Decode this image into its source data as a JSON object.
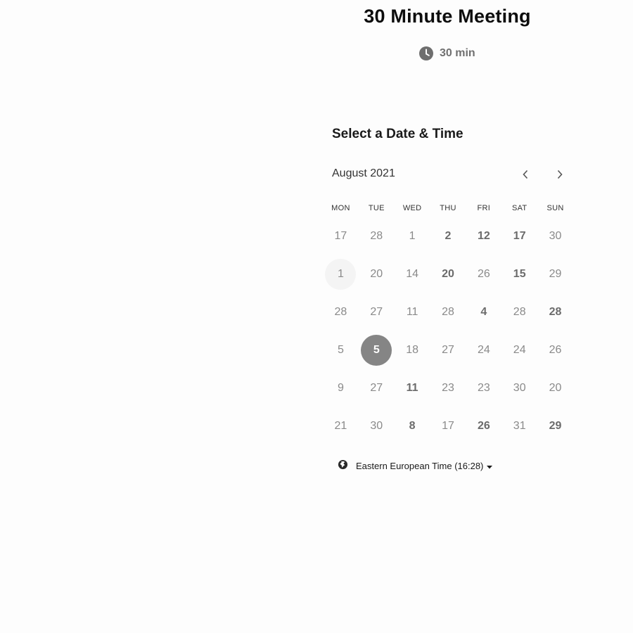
{
  "event": {
    "title": "30 Minute Meeting",
    "duration": "30 min"
  },
  "calendar": {
    "section_title": "Select a Date & Time",
    "month_label": "August 2021",
    "weekdays": [
      "MON",
      "TUE",
      "WED",
      "THU",
      "FRI",
      "SAT",
      "SUN"
    ],
    "rows": [
      [
        {
          "d": "17",
          "s": "off"
        },
        {
          "d": "28",
          "s": "off"
        },
        {
          "d": "1",
          "s": "off"
        },
        {
          "d": "2",
          "s": "avail"
        },
        {
          "d": "12",
          "s": "avail"
        },
        {
          "d": "17",
          "s": "avail"
        },
        {
          "d": "30",
          "s": "off"
        }
      ],
      [
        {
          "d": "1",
          "s": "today"
        },
        {
          "d": "20",
          "s": "off"
        },
        {
          "d": "14",
          "s": "off"
        },
        {
          "d": "20",
          "s": "avail"
        },
        {
          "d": "26",
          "s": "off"
        },
        {
          "d": "15",
          "s": "avail"
        },
        {
          "d": "29",
          "s": "off"
        }
      ],
      [
        {
          "d": "28",
          "s": "off"
        },
        {
          "d": "27",
          "s": "off"
        },
        {
          "d": "11",
          "s": "off"
        },
        {
          "d": "28",
          "s": "off"
        },
        {
          "d": "4",
          "s": "avail"
        },
        {
          "d": "28",
          "s": "off"
        },
        {
          "d": "28",
          "s": "avail"
        }
      ],
      [
        {
          "d": "5",
          "s": "off"
        },
        {
          "d": "5",
          "s": "selected"
        },
        {
          "d": "18",
          "s": "off"
        },
        {
          "d": "27",
          "s": "off"
        },
        {
          "d": "24",
          "s": "off"
        },
        {
          "d": "24",
          "s": "off"
        },
        {
          "d": "26",
          "s": "off"
        }
      ],
      [
        {
          "d": "9",
          "s": "off"
        },
        {
          "d": "27",
          "s": "off"
        },
        {
          "d": "11",
          "s": "avail"
        },
        {
          "d": "23",
          "s": "off"
        },
        {
          "d": "23",
          "s": "off"
        },
        {
          "d": "30",
          "s": "off"
        },
        {
          "d": "20",
          "s": "off"
        }
      ],
      [
        {
          "d": "21",
          "s": "off"
        },
        {
          "d": "30",
          "s": "off"
        },
        {
          "d": "8",
          "s": "avail"
        },
        {
          "d": "17",
          "s": "off"
        },
        {
          "d": "26",
          "s": "avail"
        },
        {
          "d": "31",
          "s": "off"
        },
        {
          "d": "29",
          "s": "avail"
        }
      ]
    ]
  },
  "timezone": {
    "label": "Eastern European Time (16:28)"
  },
  "icons": {
    "clock": "clock-icon",
    "prev": "chevron-left-icon",
    "next": "chevron-right-icon",
    "globe": "globe-icon",
    "caret": "caret-down-icon"
  },
  "colors": {
    "selected_bg": "#858585",
    "available_text": "#6b6b6b",
    "unavailable_text": "#8a8a8a"
  }
}
